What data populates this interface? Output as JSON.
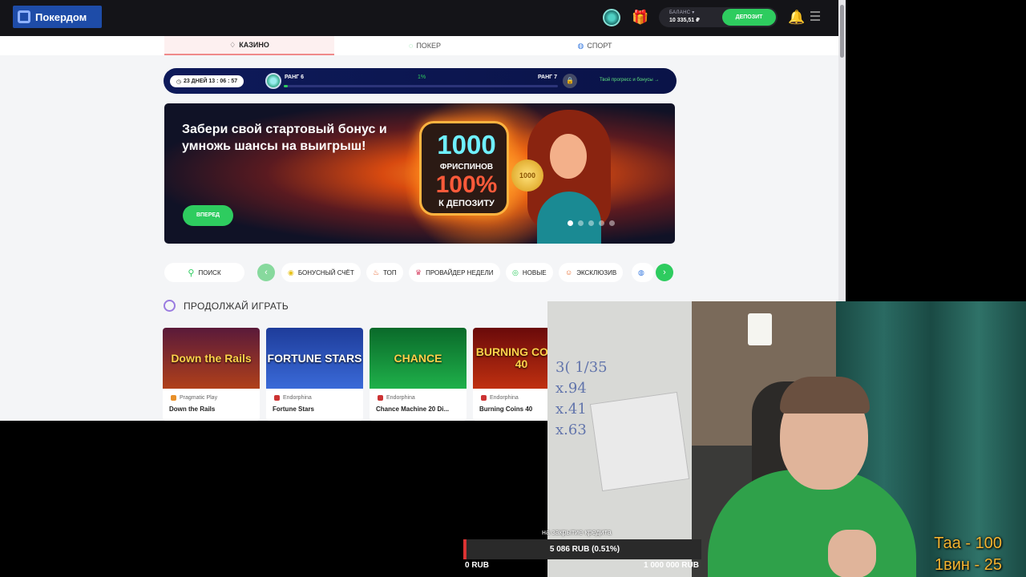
{
  "header": {
    "logo_text": "Покердом",
    "balance_label": "БАЛАНС ▾",
    "balance_value": "10 335,51 ₽",
    "deposit_label": "ДЕПОЗИТ",
    "accent_color": "#2ecc5f"
  },
  "section_tabs": [
    {
      "label": "КАЗИНО",
      "icon": "casino-icon",
      "active": true
    },
    {
      "label": "ПОКЕР",
      "icon": "poker-icon",
      "active": false
    },
    {
      "label": "СПОРТ",
      "icon": "sport-icon",
      "active": false
    }
  ],
  "progress": {
    "timer": "23 ДНЕЙ 13 : 06 : 57",
    "current_rank": "РАНГ 6",
    "next_rank": "РАНГ 7",
    "percent_text": "1%",
    "percent_value": 0.01,
    "link": "Твой прогресс и бонусы →"
  },
  "banner": {
    "title": "Забери свой стартовый бонус и умножь шансы на выигрыш!",
    "big_number": "1000",
    "freespins": "ФРИСПИНОВ",
    "percent": "100%",
    "to_deposit": "К ДЕПОЗИТУ",
    "coin_text": "1000",
    "button": "ВПЕРЕД",
    "slides": 5,
    "active_slide": 0
  },
  "filters": {
    "search": "ПОИСК",
    "chips": [
      {
        "label": "БОНУСНЫЙ СЧЁТ",
        "icon": "bonus-icon"
      },
      {
        "label": "ТОП",
        "icon": "fire-icon"
      },
      {
        "label": "ПРОВАЙДЕР НЕДЕЛИ",
        "icon": "provider-icon"
      },
      {
        "label": "НОВЫЕ",
        "icon": "new-icon"
      },
      {
        "label": "ЭКСКЛЮЗИВ",
        "icon": "exclusive-icon"
      }
    ]
  },
  "continue_section": {
    "title": "ПРОДОЛЖАЙ ИГРАТЬ"
  },
  "games": [
    {
      "art": "Down the Rails",
      "provider": "Pragmatic Play",
      "name": "Down the Rails"
    },
    {
      "art": "FORTUNE STARS",
      "provider": "Endorphina",
      "name": "Fortune Stars"
    },
    {
      "art": "CHANCE",
      "provider": "Endorphina",
      "name": "Chance Machine 20 Di..."
    },
    {
      "art": "BURNING COINS 40",
      "provider": "Endorphina",
      "name": "Burning Coins 40"
    }
  ],
  "overlay": {
    "credit_label": "на закрытие кредита",
    "credit_value": "5 086 RUB (0.51%)",
    "credit_fraction": 0.0051,
    "credit_min": "0 RUB",
    "credit_max": "1 000 000 RUB",
    "promo_lines": [
      "Таа - 100",
      "1вин - 25"
    ]
  }
}
